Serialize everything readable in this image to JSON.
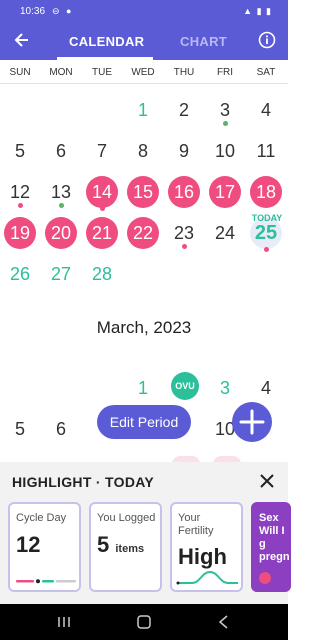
{
  "status_bar": {
    "time": "10:36"
  },
  "app_bar": {
    "tabs": [
      "CALENDAR",
      "CHART"
    ],
    "active_tab": "CALENDAR"
  },
  "weekdays": [
    "SUN",
    "MON",
    "TUE",
    "WED",
    "THU",
    "FRI",
    "SAT"
  ],
  "february": {
    "today_label": "TODAY",
    "days": [
      {
        "d": "1",
        "style": "green",
        "col": 3,
        "row": 0
      },
      {
        "d": "2",
        "style": "",
        "col": 4,
        "row": 0
      },
      {
        "d": "3",
        "style": "",
        "col": 5,
        "row": 0,
        "mark": "check"
      },
      {
        "d": "4",
        "style": "",
        "col": 6,
        "row": 0
      },
      {
        "d": "5",
        "style": "",
        "col": 0,
        "row": 1
      },
      {
        "d": "6",
        "style": "",
        "col": 1,
        "row": 1
      },
      {
        "d": "7",
        "style": "",
        "col": 2,
        "row": 1
      },
      {
        "d": "8",
        "style": "",
        "col": 3,
        "row": 1
      },
      {
        "d": "9",
        "style": "",
        "col": 4,
        "row": 1
      },
      {
        "d": "10",
        "style": "",
        "col": 5,
        "row": 1
      },
      {
        "d": "11",
        "style": "",
        "col": 6,
        "row": 1
      },
      {
        "d": "12",
        "style": "",
        "col": 0,
        "row": 2,
        "mark": "heart"
      },
      {
        "d": "13",
        "style": "",
        "col": 1,
        "row": 2,
        "mark": "check"
      },
      {
        "d": "14",
        "style": "pink",
        "col": 2,
        "row": 2,
        "mark": "heart"
      },
      {
        "d": "15",
        "style": "pink",
        "col": 3,
        "row": 2
      },
      {
        "d": "16",
        "style": "pink",
        "col": 4,
        "row": 2
      },
      {
        "d": "17",
        "style": "pink",
        "col": 5,
        "row": 2
      },
      {
        "d": "18",
        "style": "pink",
        "col": 6,
        "row": 2
      },
      {
        "d": "19",
        "style": "pink",
        "col": 0,
        "row": 3
      },
      {
        "d": "20",
        "style": "pink",
        "col": 1,
        "row": 3
      },
      {
        "d": "21",
        "style": "pink",
        "col": 2,
        "row": 3
      },
      {
        "d": "22",
        "style": "pink",
        "col": 3,
        "row": 3
      },
      {
        "d": "23",
        "style": "",
        "col": 4,
        "row": 3,
        "mark": "heart"
      },
      {
        "d": "24",
        "style": "",
        "col": 5,
        "row": 3
      },
      {
        "d": "25",
        "style": "today",
        "col": 6,
        "row": 3,
        "mark": "heart"
      },
      {
        "d": "26",
        "style": "green",
        "col": 0,
        "row": 4
      },
      {
        "d": "27",
        "style": "green",
        "col": 1,
        "row": 4
      },
      {
        "d": "28",
        "style": "green",
        "col": 2,
        "row": 4
      }
    ]
  },
  "march": {
    "title": "March, 2023",
    "days": [
      {
        "d": "1",
        "style": "green",
        "col": 3,
        "row": 0
      },
      {
        "d": "3",
        "style": "green",
        "col": 5,
        "row": 0
      },
      {
        "d": "4",
        "style": "",
        "col": 6,
        "row": 0
      },
      {
        "d": "5",
        "style": "",
        "col": 0,
        "row": 1
      },
      {
        "d": "6",
        "style": "",
        "col": 1,
        "row": 1
      },
      {
        "d": "10",
        "style": "",
        "col": 5,
        "row": 1
      }
    ],
    "ovulation_label": "OVU"
  },
  "edit_period_label": "Edit Period",
  "highlight": {
    "title": "HIGHLIGHT · TODAY",
    "cycle_day": {
      "label": "Cycle Day",
      "value": "12"
    },
    "logged": {
      "label": "You Logged",
      "value": "5",
      "unit": "items"
    },
    "fertility": {
      "label_line1": "Your",
      "label_line2": "Fertility",
      "value": "High"
    },
    "article": {
      "line1": "Sex",
      "line2": "Will I g",
      "line3": "pregn"
    }
  },
  "colors": {
    "brand": "#5b5bd6",
    "period": "#ef4c7f",
    "fertile": "#2bbf9a",
    "article": "#8c3fc0"
  }
}
